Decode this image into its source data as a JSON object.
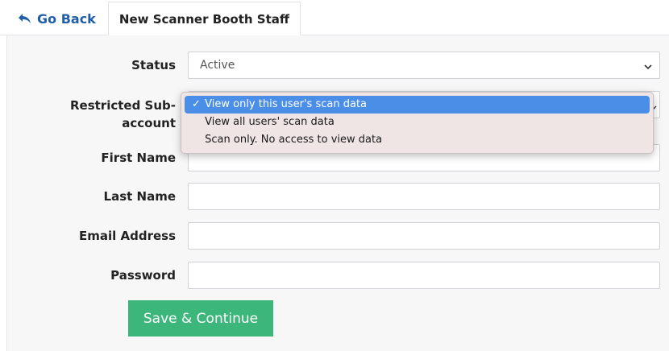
{
  "tabs": {
    "back_label": "Go Back",
    "active_label": "New Scanner Booth Staff"
  },
  "form": {
    "status": {
      "label": "Status",
      "value": "Active"
    },
    "restricted": {
      "label_line1": "Restricted Sub-",
      "label_line2": "account",
      "options": [
        "View only this user's scan data",
        "View all users' scan data",
        "Scan only. No access to view data"
      ],
      "selected_mark": "✓"
    },
    "first_name": {
      "label": "First Name",
      "value": ""
    },
    "last_name": {
      "label": "Last Name",
      "value": ""
    },
    "email": {
      "label": "Email Address",
      "value": ""
    },
    "password": {
      "label": "Password",
      "value": ""
    },
    "save_label": "Save & Continue"
  },
  "colors": {
    "link": "#1f5ea8",
    "save_button": "#3cb67b",
    "selected_option": "#4a8ee8",
    "panel_bg": "#f7f7f8"
  }
}
